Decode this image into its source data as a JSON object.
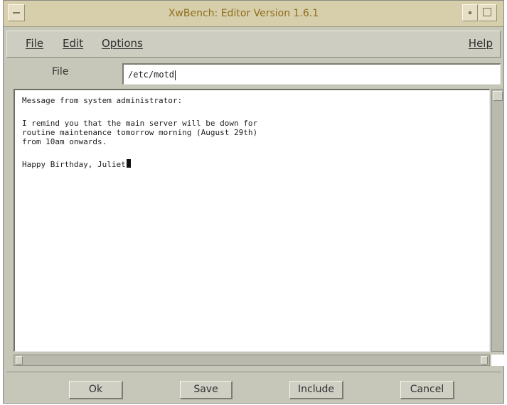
{
  "window": {
    "title": "XwBench: Editor Version 1.6.1"
  },
  "menubar": {
    "items": [
      {
        "label": "File"
      },
      {
        "label": "Edit"
      },
      {
        "label": "Options"
      }
    ],
    "help": "Help"
  },
  "file_field": {
    "label": "File",
    "value": "/etc/motd"
  },
  "editor": {
    "lines": [
      "Message from system administrator:",
      "",
      "I remind you that the main server will be down for",
      "routine maintenance tomorrow morning (August 29th)",
      "from 10am onwards.",
      "",
      "Happy Birthday, Juliet"
    ]
  },
  "buttons": {
    "ok": "Ok",
    "save": "Save",
    "include": "Include",
    "cancel": "Cancel"
  },
  "colors": {
    "titlebar": "#d7ceac",
    "title_text": "#8d6e1a",
    "window_bg": "#c6c6b9"
  }
}
